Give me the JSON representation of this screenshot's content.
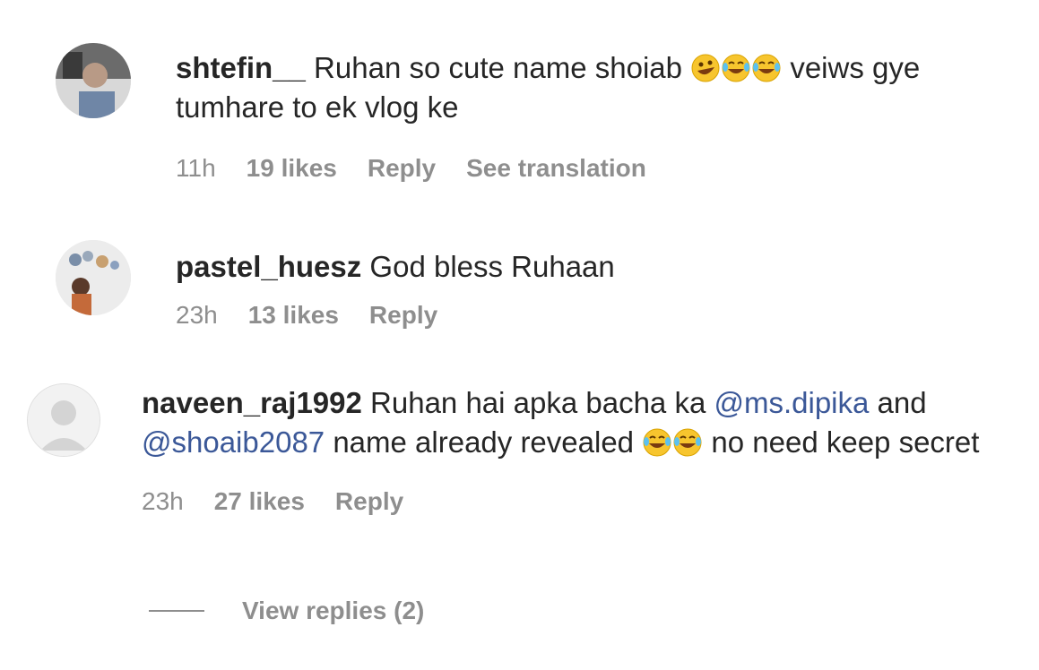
{
  "comments": [
    {
      "username": "shtefin__",
      "text_before_emoji": "Ruhan so cute name shoiab",
      "emojis": [
        "rolling-on-floor-laughing",
        "tears-of-joy",
        "tears-of-joy"
      ],
      "text_after_emoji_line1": "veiws gye",
      "text_line2": "tumhare to ek vlog ke",
      "time": "11h",
      "likes": "19 likes",
      "reply": "Reply",
      "see_translation": "See translation"
    },
    {
      "username": "pastel_huesz",
      "text": "God bless Ruhaan",
      "time": "23h",
      "likes": "13 likes",
      "reply": "Reply"
    },
    {
      "username": "naveen_raj1992",
      "text_part1": "Ruhan hai apka bacha ka",
      "mention1": "@ms.dipika",
      "text_part2": "and",
      "mention2": "@shoaib2087",
      "text_part3": "name already revealed",
      "emojis": [
        "tears-of-joy",
        "tears-of-joy"
      ],
      "text_part4": "no need keep",
      "text_part5": "secret",
      "time": "23h",
      "likes": "27 likes",
      "reply": "Reply"
    }
  ],
  "view_replies": "View replies (2)",
  "colors": {
    "text": "#262626",
    "meta": "#8e8e8e",
    "mention": "#3b5898",
    "background": "#ffffff"
  }
}
